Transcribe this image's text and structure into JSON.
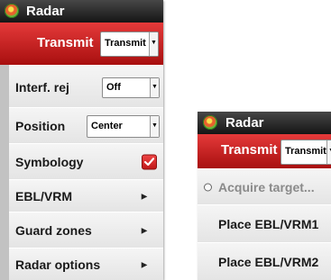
{
  "menu_radar": {
    "title": "Radar",
    "transmit": {
      "label": "Transmit",
      "value": "Transmit"
    },
    "interference": {
      "label": "Interf. rej",
      "value": "Off"
    },
    "position": {
      "label": "Position",
      "value": "Center"
    },
    "symbology": {
      "label": "Symbology",
      "checked": true
    },
    "ebl_vrm": {
      "label": "EBL/VRM"
    },
    "guard_zones": {
      "label": "Guard zones"
    },
    "radar_options": {
      "label": "Radar options"
    }
  },
  "menu_context": {
    "title": "Radar",
    "transmit": {
      "label": "Transmit",
      "value": "Transmit"
    },
    "acquire_target": {
      "label": "Acquire target..."
    },
    "place_ebl1": {
      "label": "Place EBL/VRM1"
    },
    "place_ebl2": {
      "label": "Place EBL/VRM2"
    }
  },
  "icons": {
    "logo": "radar-app-icon",
    "dropdown": "chevron-down-icon",
    "submenu": "chevron-right-icon",
    "checkbox": "checkmark-icon",
    "radio": "radio-circle-icon"
  },
  "colors": {
    "title_bar": "#151515",
    "transmit_bar": "#d42b2b",
    "menu_bg": "#eeeeee",
    "checkbox": "#d92a2a",
    "disabled_text": "#8a8a8a"
  }
}
